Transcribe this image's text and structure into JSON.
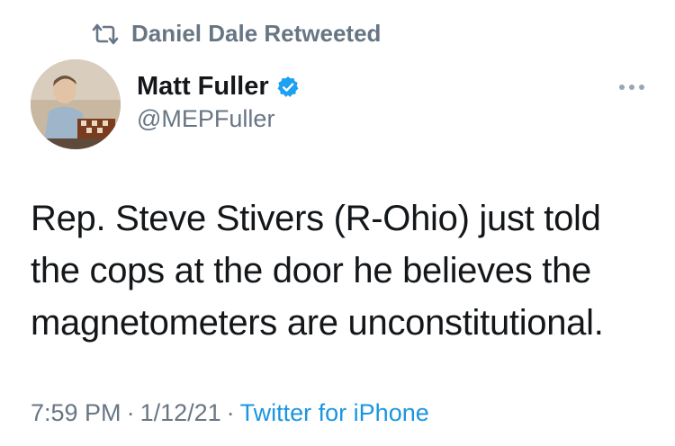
{
  "retweet": {
    "icon": "retweet-icon",
    "label": "Daniel Dale Retweeted"
  },
  "author": {
    "display_name": "Matt Fuller",
    "handle": "@MEPFuller",
    "verified": true,
    "verified_icon": "verified-badge-icon",
    "verified_color": "#1da1f2"
  },
  "tweet": {
    "line1": "Rep. Steve Stivers (R-Ohio) just told",
    "line2": "the cops at the door he believes the",
    "line3": "magnetometers are unconstitutional."
  },
  "meta": {
    "time": "7:59 PM",
    "separator": "·",
    "date": "1/12/21",
    "source": "Twitter for iPhone"
  },
  "colors": {
    "text": "#14171a",
    "secondary": "#687684",
    "link": "#1b95e0"
  }
}
